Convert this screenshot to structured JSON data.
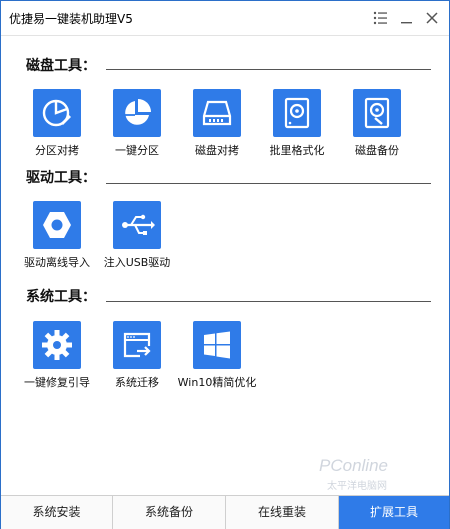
{
  "window": {
    "title": "优捷易一键装机助理V5"
  },
  "sections": [
    {
      "title": "磁盘工具：",
      "tools": [
        {
          "label": "分区对拷",
          "icon": "pie-edit-icon"
        },
        {
          "label": "一键分区",
          "icon": "pie-chart-icon"
        },
        {
          "label": "磁盘对拷",
          "icon": "hard-drive-icon"
        },
        {
          "label": "批里格式化",
          "icon": "disk-format-icon"
        },
        {
          "label": "磁盘备份",
          "icon": "disk-backup-icon"
        }
      ]
    },
    {
      "title": "驱动工具：",
      "tools": [
        {
          "label": "驱动离线导入",
          "icon": "hex-nut-icon"
        },
        {
          "label": "注入USB驱动",
          "icon": "usb-icon"
        }
      ]
    },
    {
      "title": "系统工具：",
      "tools": [
        {
          "label": "一键修复引导",
          "icon": "gear-icon"
        },
        {
          "label": "系统迁移",
          "icon": "window-migrate-icon"
        },
        {
          "label": "Win10精简优化",
          "icon": "windows-logo-icon"
        }
      ]
    }
  ],
  "tabs": [
    {
      "label": "系统安装",
      "active": false
    },
    {
      "label": "系统备份",
      "active": false
    },
    {
      "label": "在线重装",
      "active": false
    },
    {
      "label": "扩展工具",
      "active": true
    }
  ],
  "watermark": {
    "line1": "PConline",
    "line2": "太平洋电脑网"
  },
  "colors": {
    "accent": "#2f7be8",
    "window_border": "#2b6fc9"
  }
}
